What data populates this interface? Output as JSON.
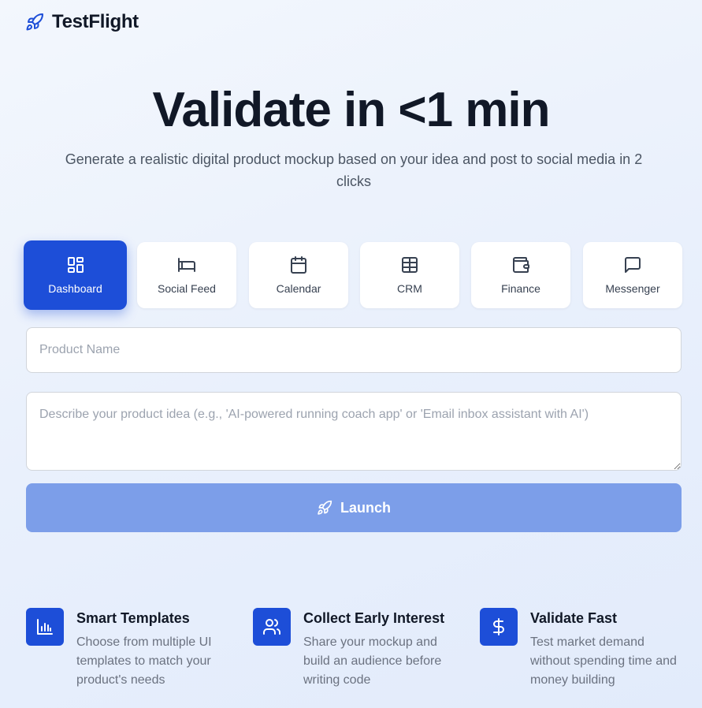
{
  "header": {
    "brand": "TestFlight",
    "logo_icon": "rocket-icon"
  },
  "hero": {
    "title": "Validate in <1 min",
    "subtitle": "Generate a realistic digital product mockup based on your idea and post to social media in 2 clicks"
  },
  "templates": {
    "selected": "Dashboard",
    "items": [
      {
        "label": "Dashboard",
        "icon": "dashboard-grid-icon"
      },
      {
        "label": "Social Feed",
        "icon": "bed-icon"
      },
      {
        "label": "Calendar",
        "icon": "calendar-icon"
      },
      {
        "label": "CRM",
        "icon": "table-grid-icon"
      },
      {
        "label": "Finance",
        "icon": "wallet-icon"
      },
      {
        "label": "Messenger",
        "icon": "chat-bubble-icon"
      }
    ]
  },
  "form": {
    "name_placeholder": "Product Name",
    "name_value": "",
    "description_placeholder": "Describe your product idea (e.g., 'AI-powered running coach app' or 'Email inbox assistant with AI')",
    "description_value": "",
    "launch_label": "Launch",
    "launch_icon": "rocket-icon"
  },
  "features": [
    {
      "title": "Smart Templates",
      "description": "Choose from multiple UI templates to match your product's needs",
      "icon": "bar-chart-icon"
    },
    {
      "title": "Collect Early Interest",
      "description": "Share your mockup and build an audience before writing code",
      "icon": "users-icon"
    },
    {
      "title": "Validate Fast",
      "description": "Test market demand without spending time and money building",
      "icon": "dollar-icon"
    }
  ],
  "colors": {
    "primary": "#1d4ed8",
    "launch_disabled": "#7c9ee9",
    "background": "#eaf1fc",
    "text_dark": "#111827",
    "text_muted": "#6b7280"
  }
}
